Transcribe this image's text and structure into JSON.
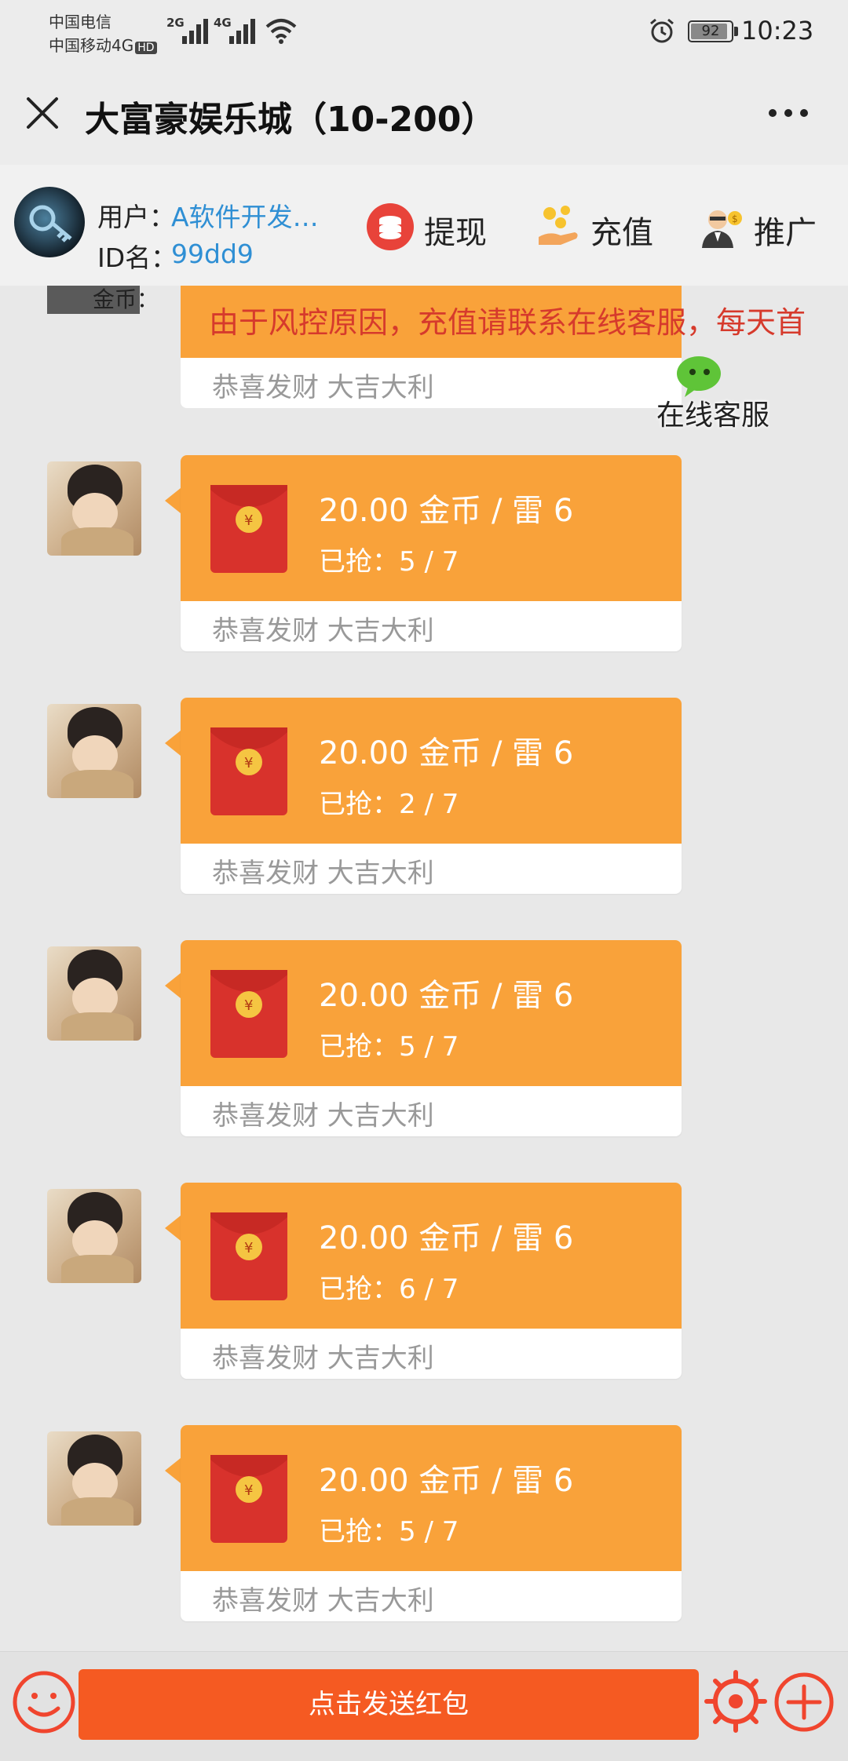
{
  "status_bar": {
    "carrier_1": "中国电信",
    "carrier_2": "中国移动4G",
    "hd_badge": "HD",
    "net_1": "2G",
    "net_2": "4G",
    "battery_percent": "92",
    "battery_level": 0.92,
    "time": "10:23",
    "icons": [
      "signal-icon",
      "wifi-icon",
      "alarm-icon",
      "battery-icon"
    ]
  },
  "header": {
    "title": "大富豪娱乐城（10-200）",
    "close_icon": "close-icon",
    "more_icon": "more-icon"
  },
  "account": {
    "user_label": "用户：",
    "user_value": "A软件开发…",
    "id_label": "ID名：",
    "id_value": "99dd9",
    "actions": [
      {
        "label": "提现",
        "icon": "coins-icon"
      },
      {
        "label": "充值",
        "icon": "recharge-icon"
      },
      {
        "label": "推广",
        "icon": "promote-icon"
      }
    ]
  },
  "notice": {
    "partial_label": "金币：",
    "marquee_text": "由于风控原因，充值请联系在线客服，每天首",
    "caption": "恭喜发财 大吉大利",
    "support_label": "在线客服",
    "support_icon": "wechat-icon"
  },
  "messages": [
    {
      "amount": "20.00 金币 / 雷 6",
      "grabbed_label": "已抢：",
      "grabbed": "5 / 7",
      "caption": "恭喜发财 大吉大利"
    },
    {
      "amount": "20.00 金币 / 雷 6",
      "grabbed_label": "已抢：",
      "grabbed": "2 / 7",
      "caption": "恭喜发财 大吉大利"
    },
    {
      "amount": "20.00 金币 / 雷 6",
      "grabbed_label": "已抢：",
      "grabbed": "5 / 7",
      "caption": "恭喜发财 大吉大利"
    },
    {
      "amount": "20.00 金币 / 雷 6",
      "grabbed_label": "已抢：",
      "grabbed": "6 / 7",
      "caption": "恭喜发财 大吉大利"
    },
    {
      "amount": "20.00 金币 / 雷 6",
      "grabbed_label": "已抢：",
      "grabbed": "5 / 7",
      "caption": "恭喜发财 大吉大利"
    }
  ],
  "footer": {
    "send_label": "点击发送红包",
    "emoji_icon": "emoji-icon",
    "settings_icon": "gear-icon",
    "add_icon": "plus-icon"
  },
  "colors": {
    "packet_orange": "#f9a23a",
    "packet_red": "#d8322c",
    "send_button": "#f55a22",
    "link_blue": "#2f8fd4",
    "notice_red": "#d63a2c"
  }
}
